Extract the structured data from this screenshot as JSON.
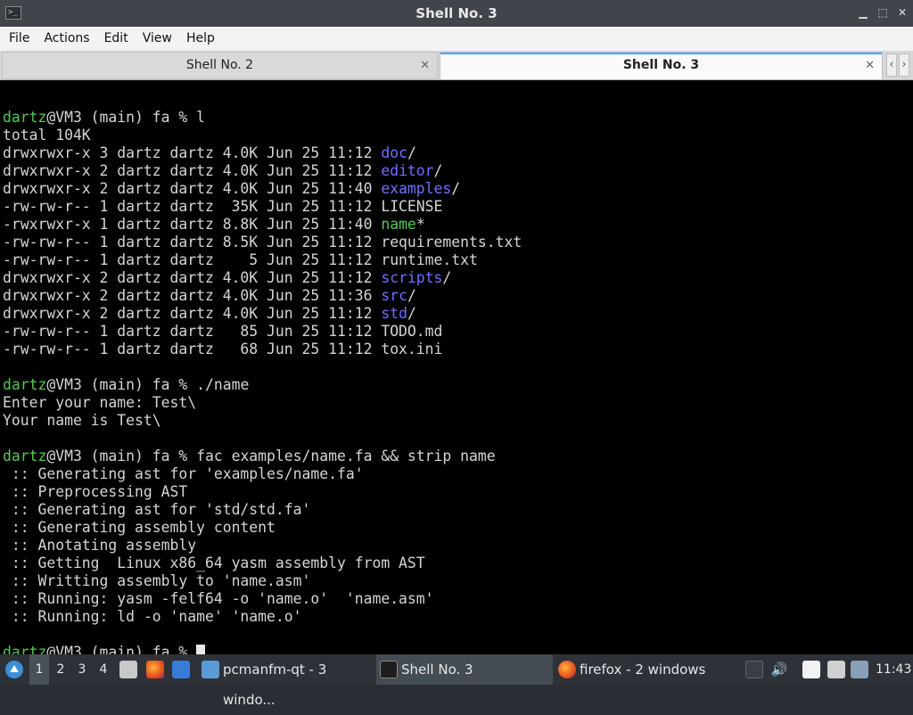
{
  "window": {
    "title": "Shell No. 3"
  },
  "menu": [
    "File",
    "Actions",
    "Edit",
    "View",
    "Help"
  ],
  "tabs": [
    {
      "label": "Shell No. 2",
      "active": false
    },
    {
      "label": "Shell No. 3",
      "active": true
    }
  ],
  "terminal": {
    "lines": [
      [],
      [
        {
          "t": "dartz",
          "c": "user"
        },
        {
          "t": "@VM3 (main) fa % l"
        }
      ],
      [
        {
          "t": "total 104K"
        }
      ],
      [
        {
          "t": "drwxrwxr-x 3 dartz dartz 4.0K Jun 25 11:12 "
        },
        {
          "t": "doc",
          "c": "dir"
        },
        {
          "t": "/"
        }
      ],
      [
        {
          "t": "drwxrwxr-x 2 dartz dartz 4.0K Jun 25 11:12 "
        },
        {
          "t": "editor",
          "c": "dir"
        },
        {
          "t": "/"
        }
      ],
      [
        {
          "t": "drwxrwxr-x 2 dartz dartz 4.0K Jun 25 11:40 "
        },
        {
          "t": "examples",
          "c": "dir"
        },
        {
          "t": "/"
        }
      ],
      [
        {
          "t": "-rw-rw-r-- 1 dartz dartz  35K Jun 25 11:12 LICENSE"
        }
      ],
      [
        {
          "t": "-rwxrwxr-x 1 dartz dartz 8.8K Jun 25 11:40 "
        },
        {
          "t": "name",
          "c": "exec"
        },
        {
          "t": "*"
        }
      ],
      [
        {
          "t": "-rw-rw-r-- 1 dartz dartz 8.5K Jun 25 11:12 requirements.txt"
        }
      ],
      [
        {
          "t": "-rw-rw-r-- 1 dartz dartz    5 Jun 25 11:12 runtime.txt"
        }
      ],
      [
        {
          "t": "drwxrwxr-x 2 dartz dartz 4.0K Jun 25 11:12 "
        },
        {
          "t": "scripts",
          "c": "dir"
        },
        {
          "t": "/"
        }
      ],
      [
        {
          "t": "drwxrwxr-x 2 dartz dartz 4.0K Jun 25 11:36 "
        },
        {
          "t": "src",
          "c": "dir"
        },
        {
          "t": "/"
        }
      ],
      [
        {
          "t": "drwxrwxr-x 2 dartz dartz 4.0K Jun 25 11:12 "
        },
        {
          "t": "std",
          "c": "dir"
        },
        {
          "t": "/"
        }
      ],
      [
        {
          "t": "-rw-rw-r-- 1 dartz dartz   85 Jun 25 11:12 TODO.md"
        }
      ],
      [
        {
          "t": "-rw-rw-r-- 1 dartz dartz   68 Jun 25 11:12 tox.ini"
        }
      ],
      [],
      [
        {
          "t": "dartz",
          "c": "user"
        },
        {
          "t": "@VM3 (main) fa % ./name"
        }
      ],
      [
        {
          "t": "Enter your name: Test\\"
        }
      ],
      [
        {
          "t": "Your name is Test\\"
        }
      ],
      [],
      [
        {
          "t": "dartz",
          "c": "user"
        },
        {
          "t": "@VM3 (main) fa % fac examples/name.fa && strip name"
        }
      ],
      [
        {
          "t": " :: Generating ast for 'examples/name.fa'"
        }
      ],
      [
        {
          "t": " :: Preprocessing AST"
        }
      ],
      [
        {
          "t": " :: Generating ast for 'std/std.fa'"
        }
      ],
      [
        {
          "t": " :: Generating assembly content"
        }
      ],
      [
        {
          "t": " :: Anotating assembly"
        }
      ],
      [
        {
          "t": " :: Getting  Linux x86_64 yasm assembly from AST"
        }
      ],
      [
        {
          "t": " :: Writting assembly to 'name.asm'"
        }
      ],
      [
        {
          "t": " :: Running: yasm -felf64 -o 'name.o'  'name.asm'"
        }
      ],
      [
        {
          "t": " :: Running: ld -o 'name' 'name.o'"
        }
      ],
      [],
      [
        {
          "t": "dartz",
          "c": "user"
        },
        {
          "t": "@VM3 (main) fa % "
        }
      ]
    ]
  },
  "taskbar": {
    "desktops": [
      "1",
      "2",
      "3",
      "4"
    ],
    "active_desktop": "1",
    "tasks": [
      {
        "label": "pcmanfm-qt - 3 windo...",
        "icon": "folder-icon"
      },
      {
        "label": "Shell No. 3",
        "icon": "terminal-icon"
      },
      {
        "label": "firefox - 2 windows",
        "icon": "firefox-icon"
      }
    ],
    "clock": "11:43"
  },
  "colors": {
    "user": "#54c754",
    "directory": "#6f6fff",
    "executable": "#54c754",
    "terminal_bg": "#000000",
    "terminal_fg": "#d4d4d4"
  }
}
